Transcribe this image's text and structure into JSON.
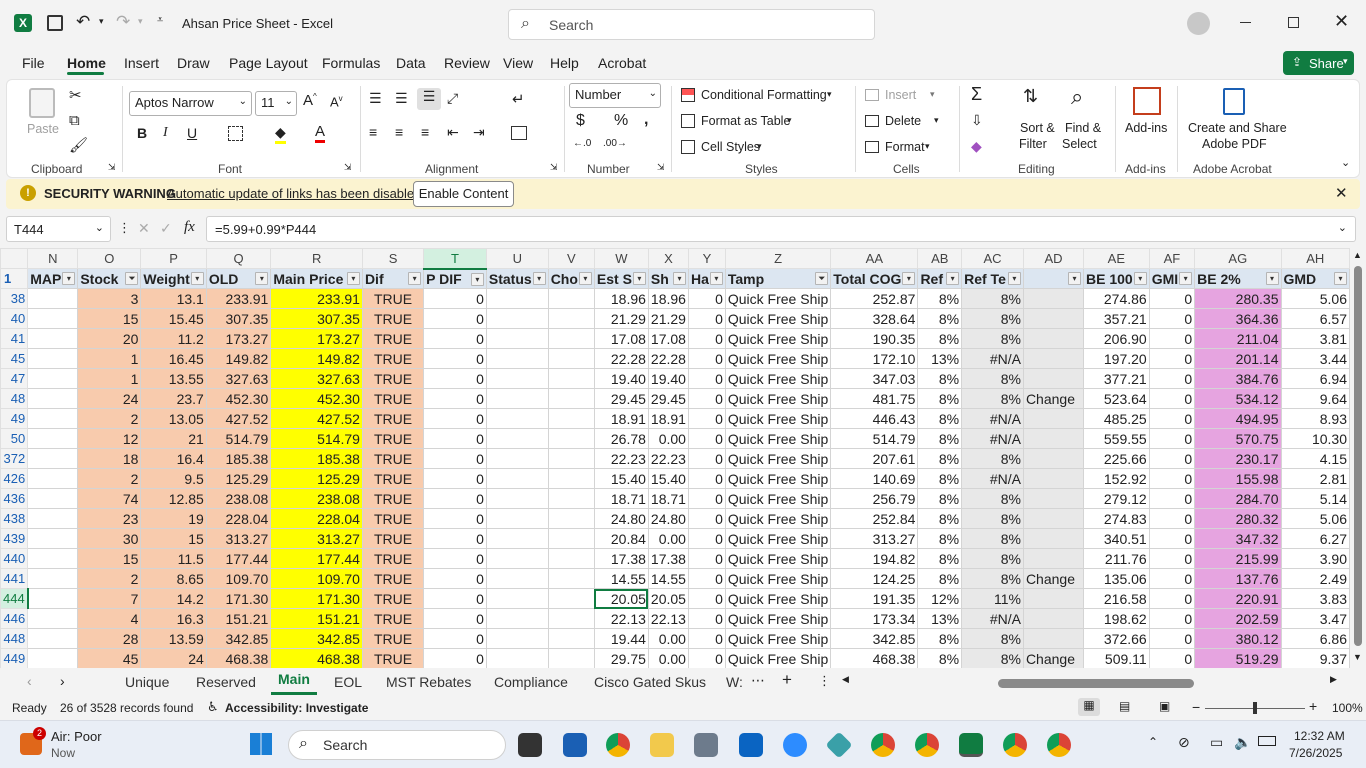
{
  "window": {
    "title": "Ahsan Price Sheet  -  Excel",
    "search_placeholder": "Search"
  },
  "menu": [
    "File",
    "Home",
    "Insert",
    "Draw",
    "Page Layout",
    "Formulas",
    "Data",
    "Review",
    "View",
    "Help",
    "Acrobat"
  ],
  "share_label": "Share",
  "ribbon": {
    "paste": "Paste",
    "font_name": "Aptos Narrow",
    "font_size": "11",
    "number_format": "Number",
    "conditional_formatting": "Conditional Formatting",
    "format_as_table": "Format as Table",
    "cell_styles": "Cell Styles",
    "insert": "Insert",
    "delete": "Delete",
    "format": "Format",
    "sort_filter": "Sort &",
    "sort_filter2": "Filter",
    "find_select": "Find &",
    "find_select2": "Select",
    "addins": "Add-ins",
    "create_share": "Create and Share",
    "adobe_pdf": "Adobe PDF",
    "groups": {
      "clipboard": "Clipboard",
      "font": "Font",
      "alignment": "Alignment",
      "number": "Number",
      "styles": "Styles",
      "cells": "Cells",
      "editing": "Editing",
      "addins": "Add-ins",
      "adobe": "Adobe Acrobat"
    }
  },
  "security": {
    "title": "SECURITY WARNING",
    "message": "Automatic update of links has been disabled",
    "button": "Enable Content"
  },
  "formula_bar": {
    "name_box": "T444",
    "fx": "fx",
    "formula": "=5.99+0.99*P444"
  },
  "columns": [
    "N",
    "O",
    "P",
    "Q",
    "R",
    "S",
    "T",
    "U",
    "V",
    "W",
    "X",
    "Y",
    "Z",
    "AA",
    "AB",
    "AC",
    "AD",
    "AE",
    "AF",
    "AG",
    "AH"
  ],
  "headers": [
    "MAP",
    "Stock",
    "Weight",
    "OLD",
    "Main Price",
    "Dif",
    "P DIF",
    "Status",
    "Cho",
    "Est S",
    "Sh",
    "Ha",
    "Tamp",
    "Total COG",
    "Ref",
    "Ref Te",
    "",
    "BE 100",
    "GMI",
    "BE 2%",
    "GMD"
  ],
  "header_row_num": "1",
  "rows": [
    {
      "r": "38",
      "o": "3",
      "p": "13.1",
      "q": "233.91",
      "rr": "233.91",
      "s": "TRUE",
      "t": "0",
      "w": "18.96",
      "x": "18.96",
      "y": "0",
      "z": "Quick Free Ship",
      "aa": "252.87",
      "ab": "8%",
      "ac": "8%",
      "ad": "",
      "ae": "274.86",
      "af": "0",
      "ag": "280.35",
      "ah": "5.06"
    },
    {
      "r": "40",
      "o": "15",
      "p": "15.45",
      "q": "307.35",
      "rr": "307.35",
      "s": "TRUE",
      "t": "0",
      "w": "21.29",
      "x": "21.29",
      "y": "0",
      "z": "Quick Free Ship",
      "aa": "328.64",
      "ab": "8%",
      "ac": "8%",
      "ad": "",
      "ae": "357.21",
      "af": "0",
      "ag": "364.36",
      "ah": "6.57"
    },
    {
      "r": "41",
      "o": "20",
      "p": "11.2",
      "q": "173.27",
      "rr": "173.27",
      "s": "TRUE",
      "t": "0",
      "w": "17.08",
      "x": "17.08",
      "y": "0",
      "z": "Quick Free Ship",
      "aa": "190.35",
      "ab": "8%",
      "ac": "8%",
      "ad": "",
      "ae": "206.90",
      "af": "0",
      "ag": "211.04",
      "ah": "3.81"
    },
    {
      "r": "45",
      "o": "1",
      "p": "16.45",
      "q": "149.82",
      "rr": "149.82",
      "s": "TRUE",
      "t": "0",
      "w": "22.28",
      "x": "22.28",
      "y": "0",
      "z": "Quick Free Ship",
      "aa": "172.10",
      "ab": "13%",
      "ac": "#N/A",
      "ad": "",
      "ae": "197.20",
      "af": "0",
      "ag": "201.14",
      "ah": "3.44"
    },
    {
      "r": "47",
      "o": "1",
      "p": "13.55",
      "q": "327.63",
      "rr": "327.63",
      "s": "TRUE",
      "t": "0",
      "w": "19.40",
      "x": "19.40",
      "y": "0",
      "z": "Quick Free Ship",
      "aa": "347.03",
      "ab": "8%",
      "ac": "8%",
      "ad": "",
      "ae": "377.21",
      "af": "0",
      "ag": "384.76",
      "ah": "6.94"
    },
    {
      "r": "48",
      "o": "24",
      "p": "23.7",
      "q": "452.30",
      "rr": "452.30",
      "s": "TRUE",
      "t": "0",
      "w": "29.45",
      "x": "29.45",
      "y": "0",
      "z": "Quick Free Ship",
      "aa": "481.75",
      "ab": "8%",
      "ac": "8%",
      "ad": "Change",
      "ae": "523.64",
      "af": "0",
      "ag": "534.12",
      "ah": "9.64"
    },
    {
      "r": "49",
      "o": "2",
      "p": "13.05",
      "q": "427.52",
      "rr": "427.52",
      "s": "TRUE",
      "t": "0",
      "w": "18.91",
      "x": "18.91",
      "y": "0",
      "z": "Quick Free Ship",
      "aa": "446.43",
      "ab": "8%",
      "ac": "#N/A",
      "ad": "",
      "ae": "485.25",
      "af": "0",
      "ag": "494.95",
      "ah": "8.93"
    },
    {
      "r": "50",
      "o": "12",
      "p": "21",
      "q": "514.79",
      "rr": "514.79",
      "s": "TRUE",
      "t": "0",
      "w": "26.78",
      "x": "0.00",
      "y": "0",
      "z": "Quick Free Ship",
      "aa": "514.79",
      "ab": "8%",
      "ac": "#N/A",
      "ad": "",
      "ae": "559.55",
      "af": "0",
      "ag": "570.75",
      "ah": "10.30"
    },
    {
      "r": "372",
      "o": "18",
      "p": "16.4",
      "q": "185.38",
      "rr": "185.38",
      "s": "TRUE",
      "t": "0",
      "w": "22.23",
      "x": "22.23",
      "y": "0",
      "z": "Quick Free Ship",
      "aa": "207.61",
      "ab": "8%",
      "ac": "8%",
      "ad": "",
      "ae": "225.66",
      "af": "0",
      "ag": "230.17",
      "ah": "4.15"
    },
    {
      "r": "426",
      "o": "2",
      "p": "9.5",
      "q": "125.29",
      "rr": "125.29",
      "s": "TRUE",
      "t": "0",
      "w": "15.40",
      "x": "15.40",
      "y": "0",
      "z": "Quick Free Ship",
      "aa": "140.69",
      "ab": "8%",
      "ac": "#N/A",
      "ad": "",
      "ae": "152.92",
      "af": "0",
      "ag": "155.98",
      "ah": "2.81"
    },
    {
      "r": "436",
      "o": "74",
      "p": "12.85",
      "q": "238.08",
      "rr": "238.08",
      "s": "TRUE",
      "t": "0",
      "w": "18.71",
      "x": "18.71",
      "y": "0",
      "z": "Quick Free Ship",
      "aa": "256.79",
      "ab": "8%",
      "ac": "8%",
      "ad": "",
      "ae": "279.12",
      "af": "0",
      "ag": "284.70",
      "ah": "5.14"
    },
    {
      "r": "438",
      "o": "23",
      "p": "19",
      "q": "228.04",
      "rr": "228.04",
      "s": "TRUE",
      "t": "0",
      "w": "24.80",
      "x": "24.80",
      "y": "0",
      "z": "Quick Free Ship",
      "aa": "252.84",
      "ab": "8%",
      "ac": "8%",
      "ad": "",
      "ae": "274.83",
      "af": "0",
      "ag": "280.32",
      "ah": "5.06"
    },
    {
      "r": "439",
      "o": "30",
      "p": "15",
      "q": "313.27",
      "rr": "313.27",
      "s": "TRUE",
      "t": "0",
      "w": "20.84",
      "x": "0.00",
      "y": "0",
      "z": "Quick Free Ship",
      "aa": "313.27",
      "ab": "8%",
      "ac": "8%",
      "ad": "",
      "ae": "340.51",
      "af": "0",
      "ag": "347.32",
      "ah": "6.27"
    },
    {
      "r": "440",
      "o": "15",
      "p": "11.5",
      "q": "177.44",
      "rr": "177.44",
      "s": "TRUE",
      "t": "0",
      "w": "17.38",
      "x": "17.38",
      "y": "0",
      "z": "Quick Free Ship",
      "aa": "194.82",
      "ab": "8%",
      "ac": "8%",
      "ad": "",
      "ae": "211.76",
      "af": "0",
      "ag": "215.99",
      "ah": "3.90"
    },
    {
      "r": "441",
      "o": "2",
      "p": "8.65",
      "q": "109.70",
      "rr": "109.70",
      "s": "TRUE",
      "t": "0",
      "w": "14.55",
      "x": "14.55",
      "y": "0",
      "z": "Quick Free Ship",
      "aa": "124.25",
      "ab": "8%",
      "ac": "8%",
      "ad": "Change",
      "ae": "135.06",
      "af": "0",
      "ag": "137.76",
      "ah": "2.49"
    },
    {
      "r": "444",
      "o": "7",
      "p": "14.2",
      "q": "171.30",
      "rr": "171.30",
      "s": "TRUE",
      "t": "0",
      "w": "20.05",
      "x": "20.05",
      "y": "0",
      "z": "Quick Free Ship",
      "aa": "191.35",
      "ab": "12%",
      "ac": "11%",
      "ad": "",
      "ae": "216.58",
      "af": "0",
      "ag": "220.91",
      "ah": "3.83"
    },
    {
      "r": "446",
      "o": "4",
      "p": "16.3",
      "q": "151.21",
      "rr": "151.21",
      "s": "TRUE",
      "t": "0",
      "w": "22.13",
      "x": "22.13",
      "y": "0",
      "z": "Quick Free Ship",
      "aa": "173.34",
      "ab": "13%",
      "ac": "#N/A",
      "ad": "",
      "ae": "198.62",
      "af": "0",
      "ag": "202.59",
      "ah": "3.47"
    },
    {
      "r": "448",
      "o": "28",
      "p": "13.59",
      "q": "342.85",
      "rr": "342.85",
      "s": "TRUE",
      "t": "0",
      "w": "19.44",
      "x": "0.00",
      "y": "0",
      "z": "Quick Free Ship",
      "aa": "342.85",
      "ab": "8%",
      "ac": "8%",
      "ad": "",
      "ae": "372.66",
      "af": "0",
      "ag": "380.12",
      "ah": "6.86"
    },
    {
      "r": "449",
      "o": "45",
      "p": "24",
      "q": "468.38",
      "rr": "468.38",
      "s": "TRUE",
      "t": "0",
      "w": "29.75",
      "x": "0.00",
      "y": "0",
      "z": "Quick Free Ship",
      "aa": "468.38",
      "ab": "8%",
      "ac": "8%",
      "ad": "Change",
      "ae": "509.11",
      "af": "0",
      "ag": "519.29",
      "ah": "9.37"
    }
  ],
  "sheet_tabs": [
    "Unique",
    "Reserved",
    "Main",
    "EOL",
    "MST Rebates",
    "Compliance",
    "Cisco Gated Skus",
    "W:"
  ],
  "status": {
    "ready": "Ready",
    "records": "26 of 3528 records found",
    "accessibility": "Accessibility: Investigate",
    "zoom": "100%"
  },
  "taskbar": {
    "weather_title": "Air: Poor",
    "weather_sub": "Now",
    "weather_badge": "2",
    "search": "Search",
    "time": "12:32 AM",
    "date": "7/26/2025"
  }
}
